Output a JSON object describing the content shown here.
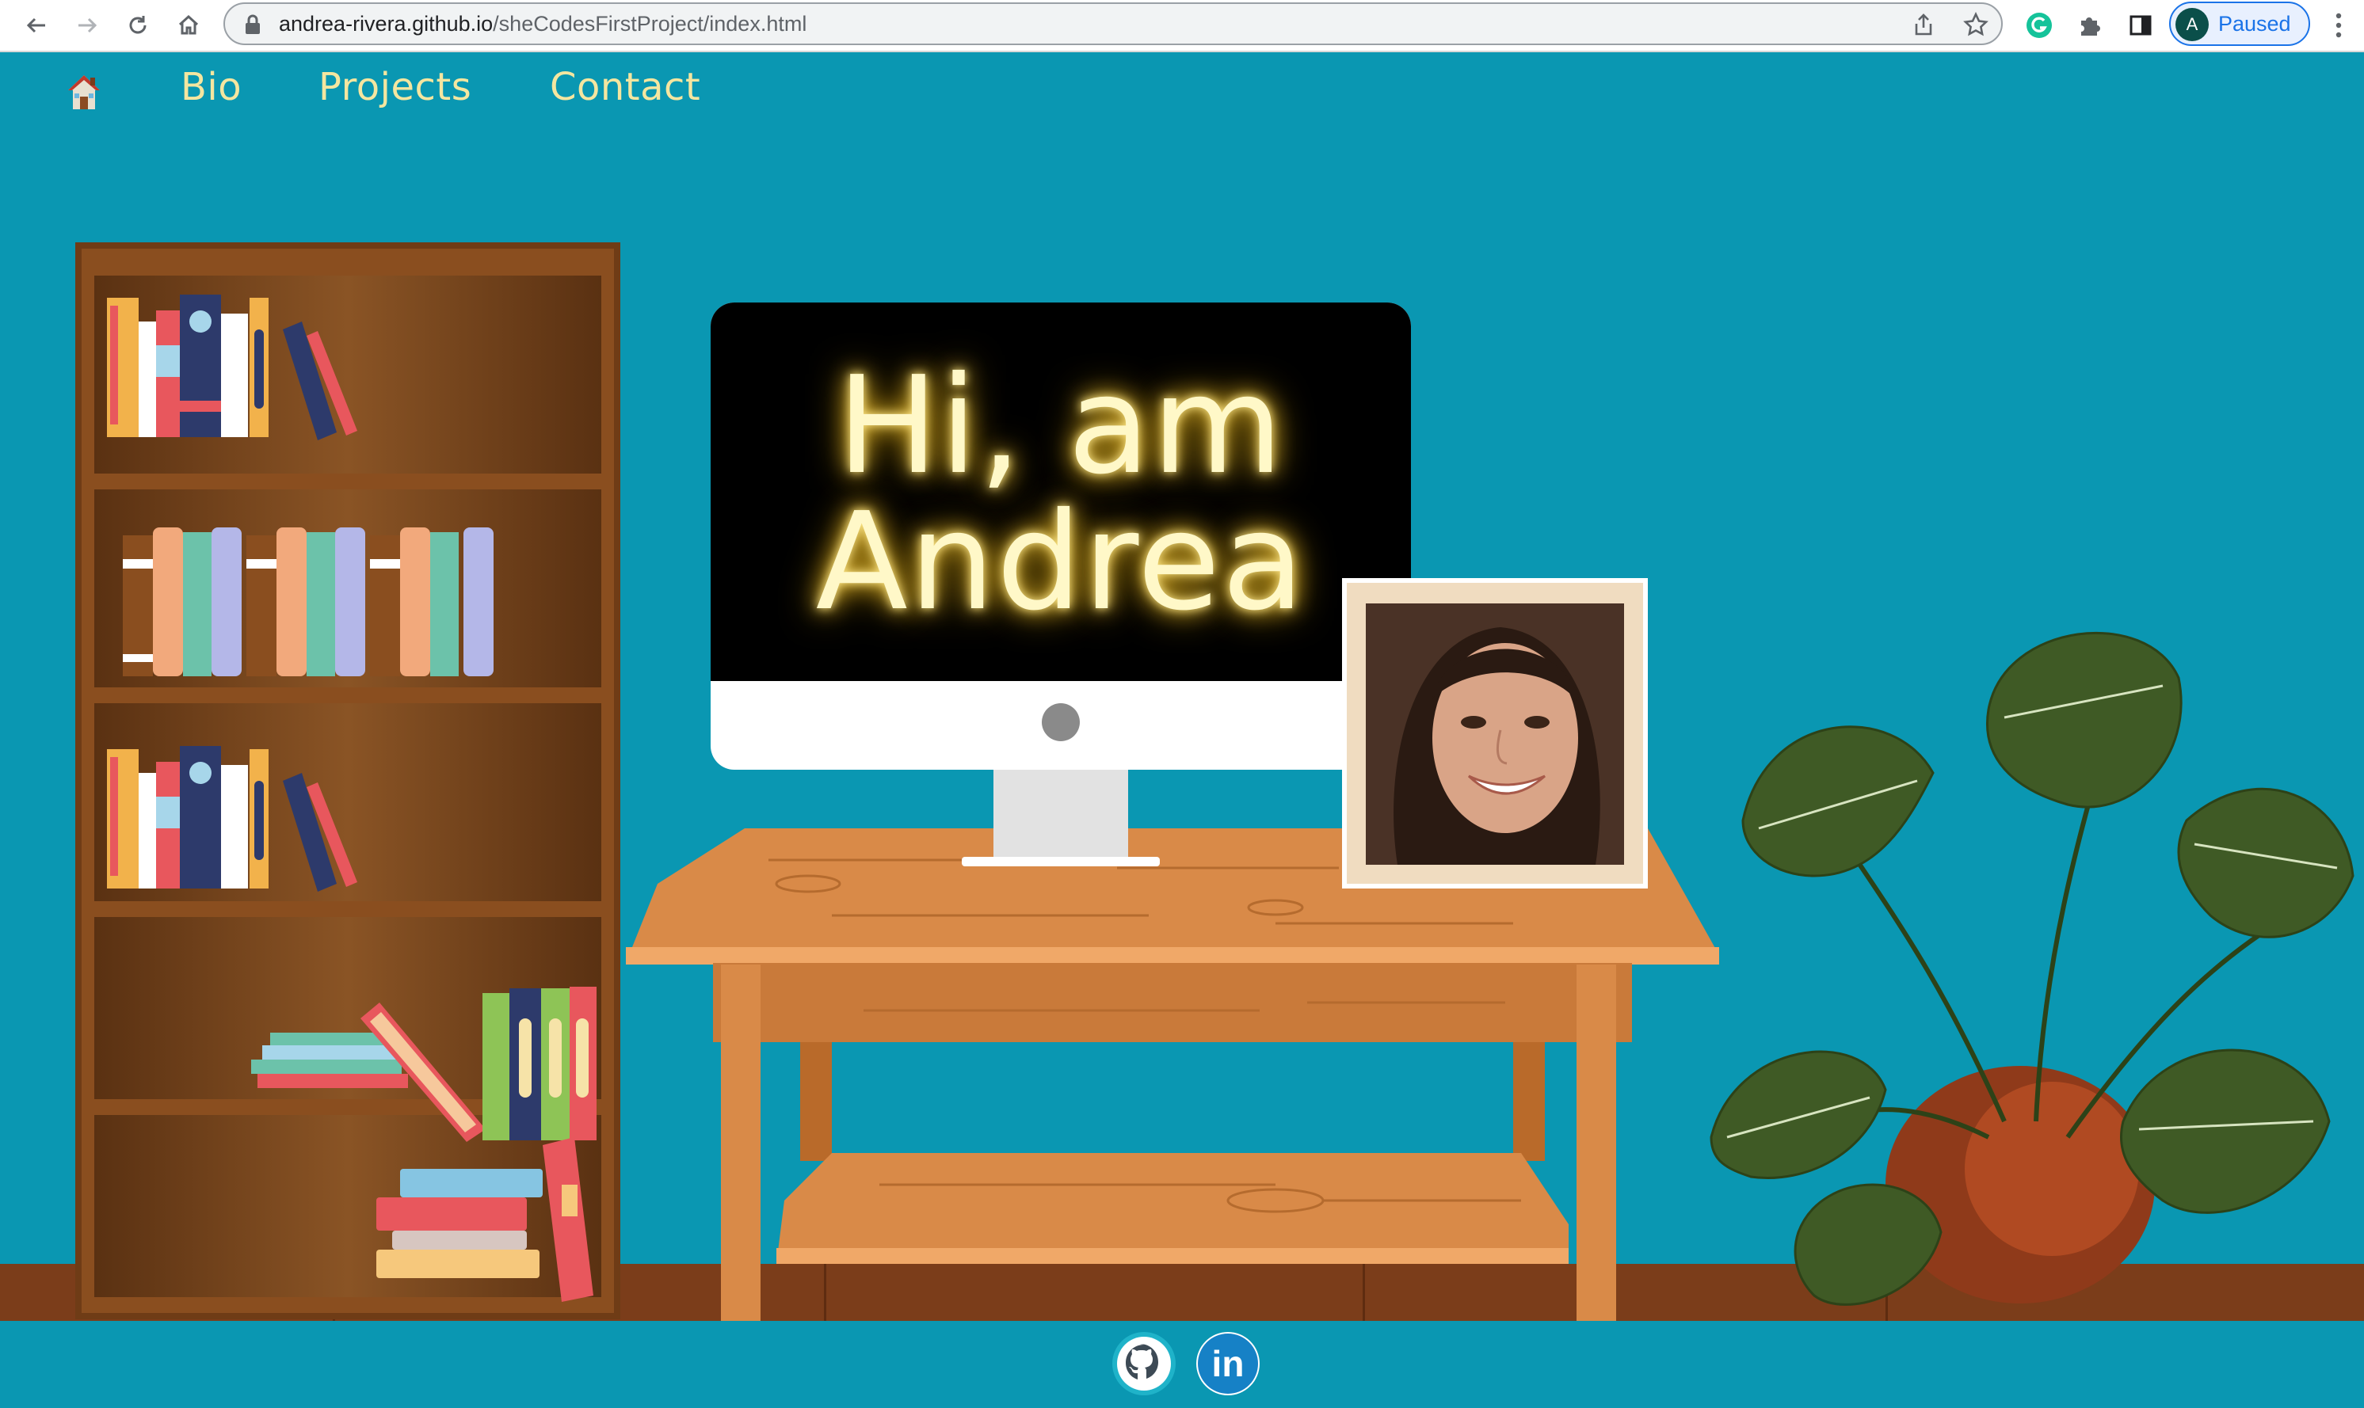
{
  "browser": {
    "url_domain": "andrea-rivera.github.io",
    "url_path": "/sheCodesFirstProject/index.html",
    "profile_initial": "A",
    "profile_status": "Paused",
    "icons": [
      "back-arrow-icon",
      "forward-arrow-icon",
      "reload-icon",
      "home-icon",
      "lock-icon",
      "share-icon",
      "bookmark-star-icon",
      "grammarly-icon",
      "extensions-puzzle-icon",
      "side-panel-icon",
      "kebab-menu-icon"
    ]
  },
  "nav": {
    "home_icon": "house-emoji-icon",
    "links": [
      "Bio",
      "Projects",
      "Contact"
    ]
  },
  "hero": {
    "line1": "Hi, am",
    "line2": "Andrea"
  },
  "footer": {
    "icons": [
      "github-icon",
      "linkedin-icon"
    ],
    "linkedin_label": "in"
  },
  "colors": {
    "background": "#0a97b2",
    "nav_text": "#f4e6a0",
    "floor": "#7b3d1a",
    "desk": "#d98a48",
    "screen_glow": "#f5c73a"
  }
}
